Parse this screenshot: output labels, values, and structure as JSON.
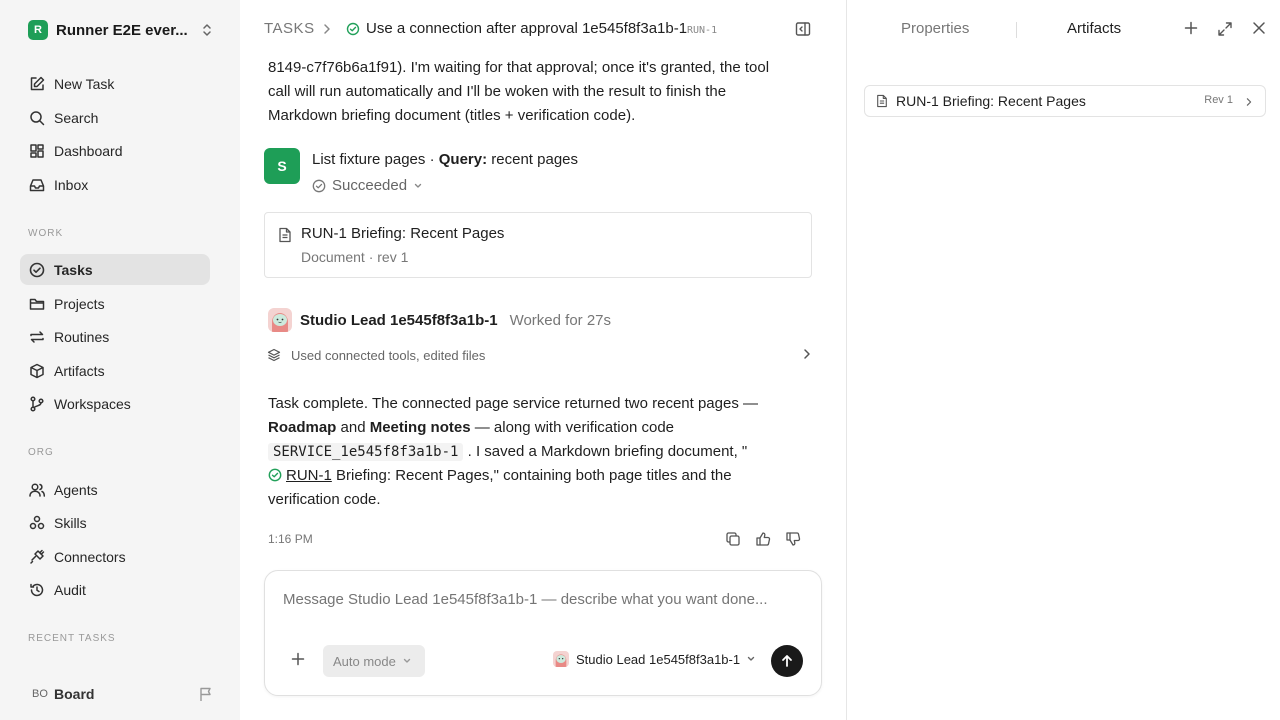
{
  "sidebar": {
    "workspace": {
      "initial": "R",
      "name": "Runner E2E ever..."
    },
    "nav": [
      {
        "label": "New Task",
        "icon": "edit-icon"
      },
      {
        "label": "Search",
        "icon": "search-icon"
      },
      {
        "label": "Dashboard",
        "icon": "dashboard-icon"
      },
      {
        "label": "Inbox",
        "icon": "inbox-icon"
      }
    ],
    "work_label": "WORK",
    "work": [
      {
        "label": "Tasks",
        "icon": "check-circle-icon",
        "active": true
      },
      {
        "label": "Projects",
        "icon": "folder-icon"
      },
      {
        "label": "Routines",
        "icon": "repeat-icon"
      },
      {
        "label": "Artifacts",
        "icon": "box-icon"
      },
      {
        "label": "Workspaces",
        "icon": "branch-icon"
      }
    ],
    "org_label": "ORG",
    "org": [
      {
        "label": "Agents",
        "icon": "users-icon"
      },
      {
        "label": "Skills",
        "icon": "skills-icon"
      },
      {
        "label": "Connectors",
        "icon": "plug-icon"
      },
      {
        "label": "Audit",
        "icon": "history-icon"
      }
    ],
    "recent_label": "RECENT TASKS",
    "board": {
      "initials": "BO",
      "name": "Board"
    }
  },
  "header": {
    "root": "TASKS",
    "title": "Use a connection after approval 1e545f8f3a1b-1",
    "run_id": "RUN-1"
  },
  "thread": {
    "approval_lines": [
      "8149-c7f76b6a1f91). I'm waiting for that approval; once it's granted, the tool",
      "call will run automatically and I'll be woken with the result to finish the",
      "Markdown briefing document (titles + verification code)."
    ],
    "tool_call": {
      "avatar": "S",
      "name": "List fixture pages",
      "separator": "·",
      "query_label": "Query:",
      "query": "recent pages",
      "status": "Succeeded"
    },
    "doc_card": {
      "title": "RUN-1 Briefing: Recent Pages",
      "meta": "Document · rev 1"
    },
    "agent": {
      "name": "Studio Lead 1e545f8f3a1b-1",
      "worked": "Worked for 27s"
    },
    "tools_summary": "Used connected tools, edited files",
    "final": {
      "t1": "Task complete. The connected page service returned two recent pages —",
      "b1": "Roadmap",
      "t2": " and ",
      "b2": "Meeting notes",
      "t3": " — along with verification code",
      "code": "SERVICE_1e545f8f3a1b-1",
      "t4": " . I saved a Markdown briefing document, \"",
      "link": "RUN-1",
      "t5": " Briefing: Recent Pages,\" containing both page titles and the",
      "t6": "verification code."
    },
    "time": "1:16 PM"
  },
  "composer": {
    "placeholder": "Message Studio Lead 1e545f8f3a1b-1 — describe what you want done...",
    "mode": "Auto mode",
    "agent": "Studio Lead 1e545f8f3a1b-1"
  },
  "right": {
    "tabs": [
      "Properties",
      "Artifacts"
    ],
    "artifact": {
      "title": "RUN-1 Briefing: Recent Pages",
      "rev": "Rev 1"
    }
  },
  "colors": {
    "success": "#22a05a",
    "brand": "#1e9e57",
    "send": "#1a1a1a"
  }
}
